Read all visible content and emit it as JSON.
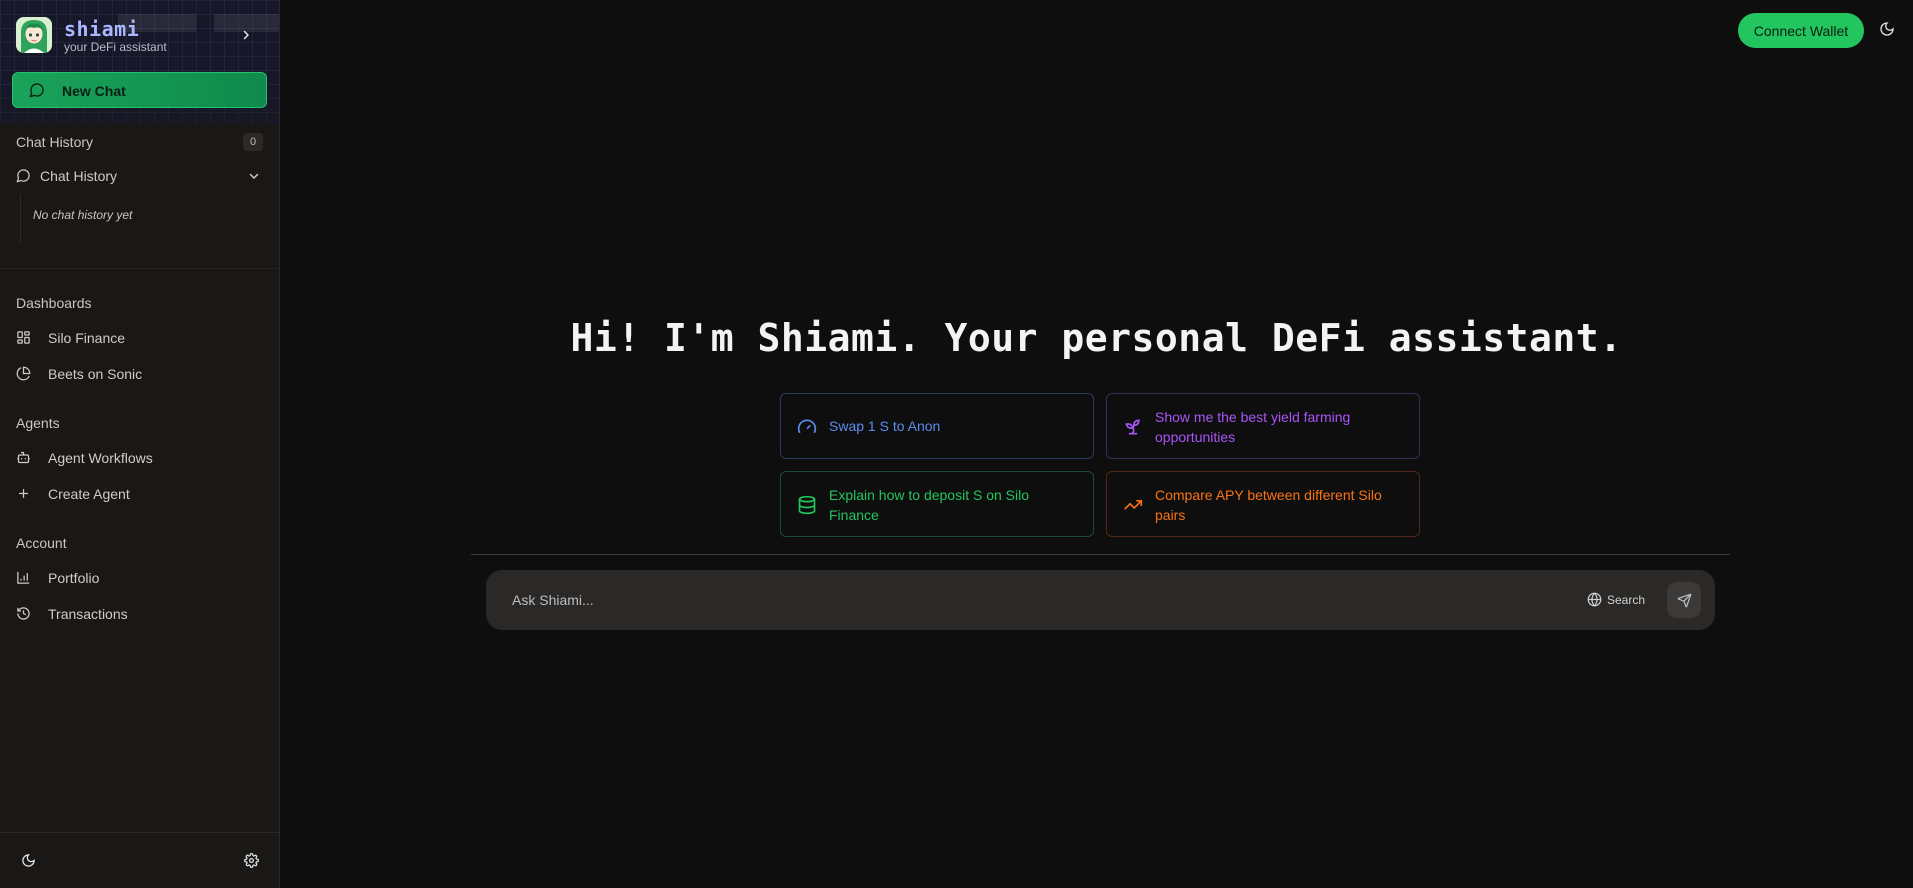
{
  "brand": {
    "name": "shiami",
    "subtitle": "your DeFi assistant"
  },
  "sidebar": {
    "new_chat_label": "New Chat",
    "chat_history": {
      "title": "Chat History",
      "count": "0",
      "toggle_label": "Chat History",
      "empty_text": "No chat history yet"
    },
    "dashboards": {
      "title": "Dashboards",
      "items": [
        {
          "label": "Silo Finance",
          "icon": "grid-icon"
        },
        {
          "label": "Beets on Sonic",
          "icon": "pie-chart-icon"
        }
      ]
    },
    "agents": {
      "title": "Agents",
      "items": [
        {
          "label": "Agent Workflows",
          "icon": "bot-icon"
        },
        {
          "label": "Create Agent",
          "icon": "plus-icon"
        }
      ]
    },
    "account": {
      "title": "Account",
      "items": [
        {
          "label": "Portfolio",
          "icon": "bar-chart-icon"
        },
        {
          "label": "Transactions",
          "icon": "history-icon"
        }
      ]
    }
  },
  "header": {
    "connect_wallet_label": "Connect Wallet"
  },
  "main": {
    "headline": "Hi! I'm Shiami. Your personal DeFi assistant.",
    "suggestions": [
      {
        "label": "Swap 1 S to Anon",
        "icon": "gauge-icon",
        "color": "#5b8def"
      },
      {
        "label": "Show me the best yield farming opportunities",
        "icon": "sprout-icon",
        "color": "#a855f7"
      },
      {
        "label": "Explain how to deposit S on Silo Finance",
        "icon": "database-icon",
        "color": "#22c55e"
      },
      {
        "label": "Compare APY between different Silo pairs",
        "icon": "trending-up-icon",
        "color": "#f97316"
      }
    ],
    "input": {
      "placeholder": "Ask Shiami...",
      "value": ""
    },
    "search_label": "Search"
  },
  "colors": {
    "accent_green": "#22c55e",
    "background": "#0f0e0e",
    "sidebar": "#1a1817"
  }
}
